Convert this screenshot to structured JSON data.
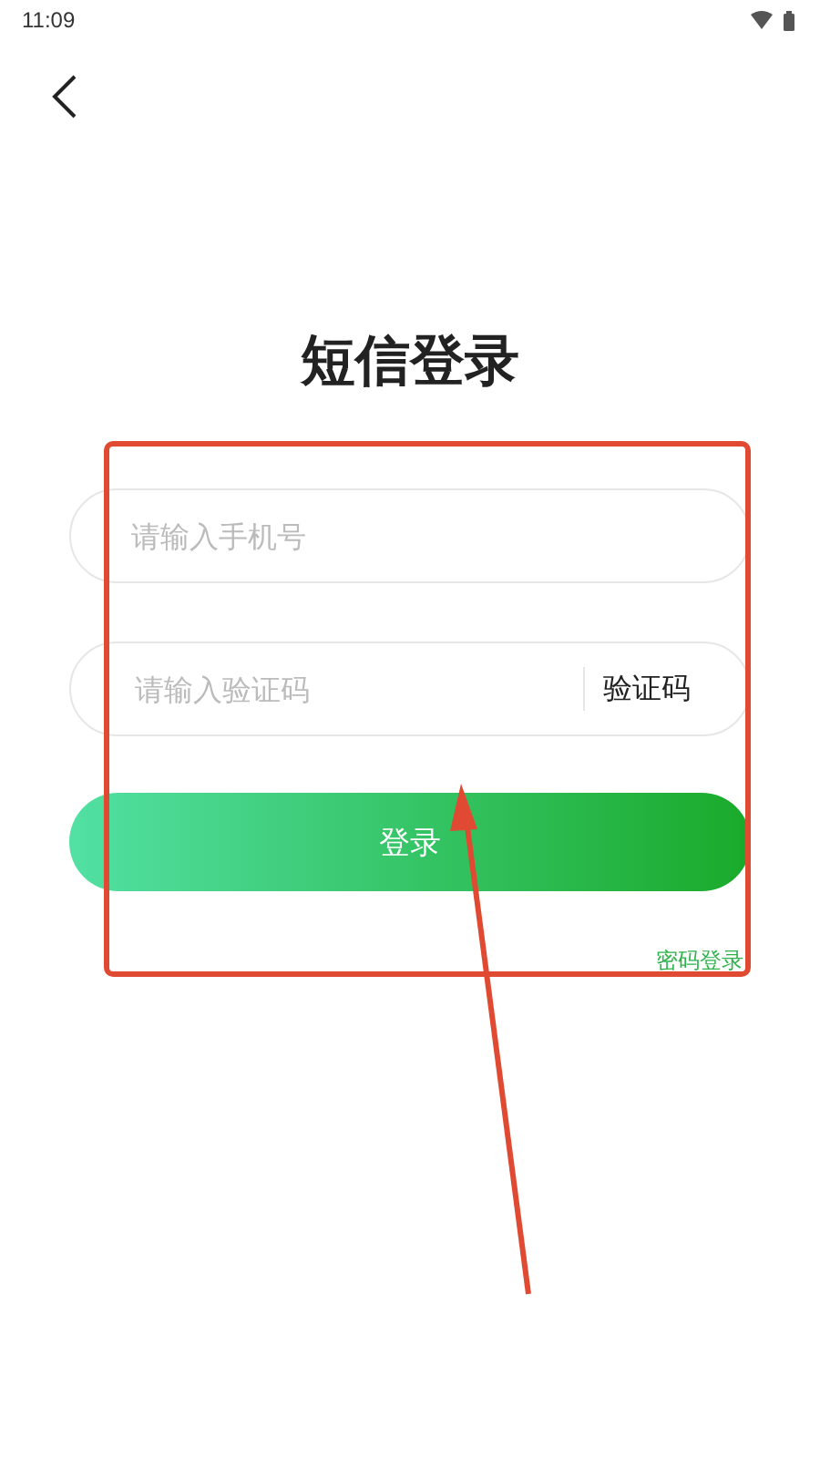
{
  "status_bar": {
    "time": "11:09"
  },
  "title": "短信登录",
  "phone_field": {
    "placeholder": "请输入手机号"
  },
  "code_field": {
    "placeholder": "请输入验证码",
    "send_code_button": "验证码"
  },
  "login_button": "登录",
  "password_login_link": "密码登录"
}
